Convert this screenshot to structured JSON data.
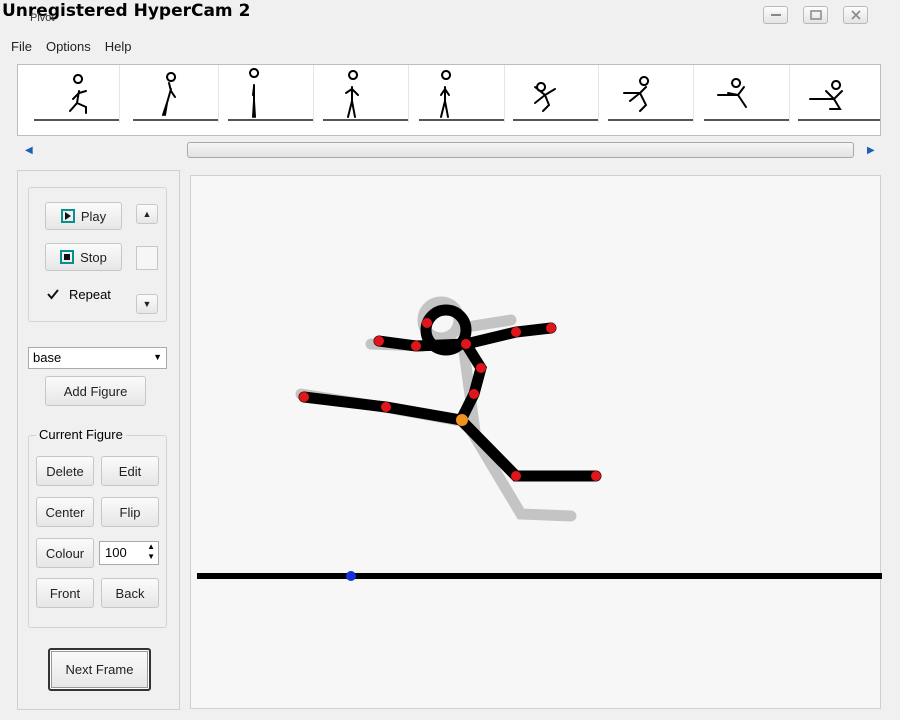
{
  "window": {
    "watermark": "Unregistered HyperCam 2",
    "title": "Pivot",
    "controls": [
      "minimize-icon",
      "maximize-icon",
      "close-icon"
    ]
  },
  "menu": [
    "File",
    "Options",
    "Help"
  ],
  "frames": {
    "count": 9,
    "poses": [
      "crouch",
      "lean",
      "stand",
      "arms-up",
      "walk",
      "leap-start",
      "leap",
      "leap-mid",
      "leap-high"
    ]
  },
  "playback": {
    "play_label": "Play",
    "stop_label": "Stop",
    "repeat_label": "Repeat",
    "repeat_checked": true
  },
  "figure_select": {
    "value": "base"
  },
  "add_figure_label": "Add Figure",
  "current_figure": {
    "legend": "Current Figure",
    "delete_label": "Delete",
    "edit_label": "Edit",
    "center_label": "Center",
    "flip_label": "Flip",
    "colour_label": "Colour",
    "colour_value": "100",
    "front_label": "Front",
    "back_label": "Back"
  },
  "next_frame_label": "Next Frame",
  "colors": {
    "joint": "#e0161b",
    "pivot_joint": "#f0901e",
    "ground_joint": "#1430d8",
    "figure": "#000000",
    "onion_skin": "#c4c4c4",
    "accent": "#0a8f8f"
  }
}
